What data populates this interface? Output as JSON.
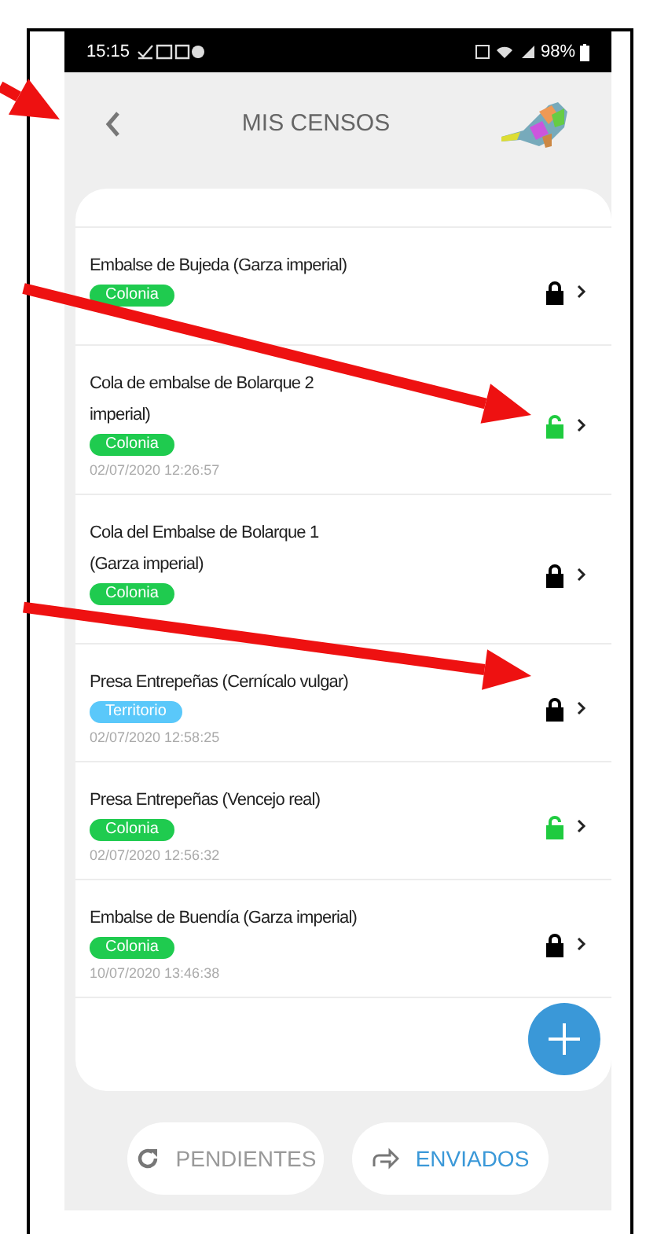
{
  "status_bar": {
    "time": "15:15",
    "battery": "98%"
  },
  "header": {
    "title": "MIS CENSOS"
  },
  "censos": [
    {
      "title": "Embalse de Bujeda (Garza imperial)",
      "tag": {
        "label": "Colonia",
        "kind": "colonia"
      },
      "locked": true
    },
    {
      "title": "Cola de embalse de Bolarque 2",
      "title_line_2": "imperial)",
      "tag": {
        "label": "Colonia",
        "kind": "colonia"
      },
      "date": "02/07/2020 12:26:57",
      "locked": false
    },
    {
      "title": "Cola del Embalse de Bolarque 1",
      "title_line_2": "(Garza imperial)",
      "tag": {
        "label": "Colonia",
        "kind": "colonia"
      },
      "locked": true
    },
    {
      "title": "Presa Entrepeñas (Cernícalo vulgar)",
      "tag": {
        "label": "Territorio",
        "kind": "territorio"
      },
      "date": "02/07/2020 12:58:25",
      "locked": true
    },
    {
      "title": "Presa Entrepeñas (Vencejo real)",
      "tag": {
        "label": "Colonia",
        "kind": "colonia"
      },
      "date": "02/07/2020 12:56:32",
      "locked": false
    },
    {
      "title": "Embalse de Buendía (Garza imperial)",
      "tag": {
        "label": "Colonia",
        "kind": "colonia"
      },
      "date": "10/07/2020 13:46:38",
      "locked": true
    }
  ],
  "tabs": [
    {
      "label": "PENDIENTES",
      "kind": "pending",
      "selected": false
    },
    {
      "label": "ENVIADOS",
      "kind": "sent",
      "selected": true
    }
  ]
}
